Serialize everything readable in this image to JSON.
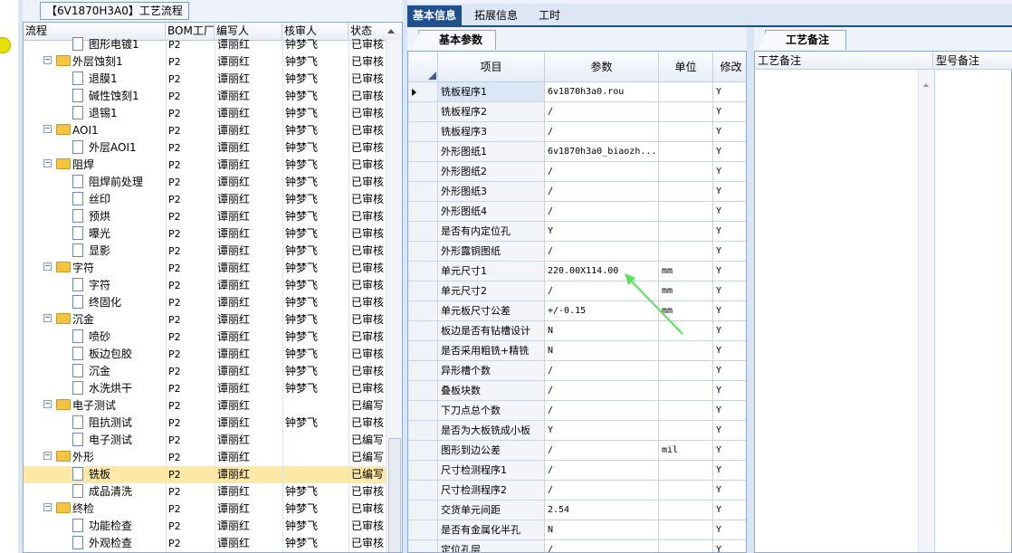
{
  "left_panel": {
    "title": "【6V1870H3A0】工艺流程",
    "columns": [
      "流程",
      "BOM工厂",
      "编写人",
      "核审人",
      "状态"
    ],
    "rows": [
      {
        "indent": 2,
        "type": "doc",
        "name": "图形电镀1",
        "bom": "P2",
        "writer": "谭丽红",
        "reviewer": "钟梦飞",
        "status": "已审核"
      },
      {
        "indent": 1,
        "type": "folder",
        "name": "外层蚀刻1",
        "bom": "P2",
        "writer": "谭丽红",
        "reviewer": "钟梦飞",
        "status": "已审核"
      },
      {
        "indent": 2,
        "type": "doc",
        "name": "退膜1",
        "bom": "P2",
        "writer": "谭丽红",
        "reviewer": "钟梦飞",
        "status": "已审核"
      },
      {
        "indent": 2,
        "type": "doc",
        "name": "碱性蚀刻1",
        "bom": "P2",
        "writer": "谭丽红",
        "reviewer": "钟梦飞",
        "status": "已审核"
      },
      {
        "indent": 2,
        "type": "doc",
        "name": "退锡1",
        "bom": "P2",
        "writer": "谭丽红",
        "reviewer": "钟梦飞",
        "status": "已审核"
      },
      {
        "indent": 1,
        "type": "folder",
        "name": "AOI1",
        "bom": "P2",
        "writer": "谭丽红",
        "reviewer": "钟梦飞",
        "status": "已审核"
      },
      {
        "indent": 2,
        "type": "doc",
        "name": "外层AOI1",
        "bom": "P2",
        "writer": "谭丽红",
        "reviewer": "钟梦飞",
        "status": "已审核"
      },
      {
        "indent": 1,
        "type": "folder",
        "name": "阻焊",
        "bom": "P2",
        "writer": "谭丽红",
        "reviewer": "钟梦飞",
        "status": "已审核"
      },
      {
        "indent": 2,
        "type": "doc",
        "name": "阻焊前处理",
        "bom": "P2",
        "writer": "谭丽红",
        "reviewer": "钟梦飞",
        "status": "已审核"
      },
      {
        "indent": 2,
        "type": "doc",
        "name": "丝印",
        "bom": "P2",
        "writer": "谭丽红",
        "reviewer": "钟梦飞",
        "status": "已审核"
      },
      {
        "indent": 2,
        "type": "doc",
        "name": "预烘",
        "bom": "P2",
        "writer": "谭丽红",
        "reviewer": "钟梦飞",
        "status": "已审核"
      },
      {
        "indent": 2,
        "type": "doc",
        "name": "曝光",
        "bom": "P2",
        "writer": "谭丽红",
        "reviewer": "钟梦飞",
        "status": "已审核"
      },
      {
        "indent": 2,
        "type": "doc",
        "name": "显影",
        "bom": "P2",
        "writer": "谭丽红",
        "reviewer": "钟梦飞",
        "status": "已审核"
      },
      {
        "indent": 1,
        "type": "folder",
        "name": "字符",
        "bom": "P2",
        "writer": "谭丽红",
        "reviewer": "钟梦飞",
        "status": "已审核"
      },
      {
        "indent": 2,
        "type": "doc",
        "name": "字符",
        "bom": "P2",
        "writer": "谭丽红",
        "reviewer": "钟梦飞",
        "status": "已审核"
      },
      {
        "indent": 2,
        "type": "doc",
        "name": "终固化",
        "bom": "P2",
        "writer": "谭丽红",
        "reviewer": "钟梦飞",
        "status": "已审核"
      },
      {
        "indent": 1,
        "type": "folder",
        "name": "沉金",
        "bom": "P2",
        "writer": "谭丽红",
        "reviewer": "钟梦飞",
        "status": "已审核"
      },
      {
        "indent": 2,
        "type": "doc",
        "name": "喷砂",
        "bom": "P2",
        "writer": "谭丽红",
        "reviewer": "钟梦飞",
        "status": "已审核"
      },
      {
        "indent": 2,
        "type": "doc",
        "name": "板边包胶",
        "bom": "P2",
        "writer": "谭丽红",
        "reviewer": "钟梦飞",
        "status": "已审核"
      },
      {
        "indent": 2,
        "type": "doc",
        "name": "沉金",
        "bom": "P2",
        "writer": "谭丽红",
        "reviewer": "钟梦飞",
        "status": "已审核"
      },
      {
        "indent": 2,
        "type": "doc",
        "name": "水洗烘干",
        "bom": "P2",
        "writer": "谭丽红",
        "reviewer": "钟梦飞",
        "status": "已审核"
      },
      {
        "indent": 1,
        "type": "folder",
        "name": "电子测试",
        "bom": "P2",
        "writer": "谭丽红",
        "reviewer": "",
        "status": "已编写"
      },
      {
        "indent": 2,
        "type": "doc",
        "name": "阻抗测试",
        "bom": "P2",
        "writer": "谭丽红",
        "reviewer": "钟梦飞",
        "status": "已审核"
      },
      {
        "indent": 2,
        "type": "doc",
        "name": "电子测试",
        "bom": "P2",
        "writer": "谭丽红",
        "reviewer": "",
        "status": "已编写"
      },
      {
        "indent": 1,
        "type": "folder",
        "name": "外形",
        "bom": "P2",
        "writer": "谭丽红",
        "reviewer": "",
        "status": "已编写"
      },
      {
        "indent": 2,
        "type": "doc",
        "name": "铣板",
        "bom": "P2",
        "writer": "谭丽红",
        "reviewer": "",
        "status": "已编写",
        "selected": true
      },
      {
        "indent": 2,
        "type": "doc",
        "name": "成品清洗",
        "bom": "P2",
        "writer": "谭丽红",
        "reviewer": "钟梦飞",
        "status": "已审核"
      },
      {
        "indent": 1,
        "type": "folder",
        "name": "终检",
        "bom": "P2",
        "writer": "谭丽红",
        "reviewer": "钟梦飞",
        "status": "已审核"
      },
      {
        "indent": 2,
        "type": "doc",
        "name": "功能检查",
        "bom": "P2",
        "writer": "谭丽红",
        "reviewer": "钟梦飞",
        "status": "已审核"
      },
      {
        "indent": 2,
        "type": "doc",
        "name": "外观检查",
        "bom": "P2",
        "writer": "谭丽红",
        "reviewer": "钟梦飞",
        "status": "已审核"
      }
    ]
  },
  "top_tabs": [
    "基本信息",
    "拓展信息",
    "工时"
  ],
  "basic_tab_label": "基本参数",
  "grid": {
    "columns": [
      "项目",
      "参数",
      "单位",
      "修改"
    ],
    "rows": [
      {
        "item": "铣板程序1",
        "param": "6v1870h3a0.rou",
        "unit": "",
        "mod": "Y"
      },
      {
        "item": "铣板程序2",
        "param": "/",
        "unit": "",
        "mod": "Y"
      },
      {
        "item": "铣板程序3",
        "param": "/",
        "unit": "",
        "mod": "Y"
      },
      {
        "item": "外形图纸1",
        "param": "6v1870h3a0_biaozh...",
        "unit": "",
        "mod": "Y"
      },
      {
        "item": "外形图纸2",
        "param": "/",
        "unit": "",
        "mod": "Y"
      },
      {
        "item": "外形图纸3",
        "param": "/",
        "unit": "",
        "mod": "Y"
      },
      {
        "item": "外形图纸4",
        "param": "/",
        "unit": "",
        "mod": "Y"
      },
      {
        "item": "是否有内定位孔",
        "param": "Y",
        "unit": "",
        "mod": "Y"
      },
      {
        "item": "外形露铜图纸",
        "param": "/",
        "unit": "",
        "mod": "Y"
      },
      {
        "item": "单元尺寸1",
        "param": "220.00X114.00",
        "unit": "mm",
        "mod": "Y"
      },
      {
        "item": "单元尺寸2",
        "param": "/",
        "unit": "mm",
        "mod": "Y"
      },
      {
        "item": "单元板尺寸公差",
        "param": "+/-0.15",
        "unit": "mm",
        "mod": "Y"
      },
      {
        "item": "板边是否有钻槽设计",
        "param": "N",
        "unit": "",
        "mod": "Y"
      },
      {
        "item": "是否采用粗铣+精铣",
        "param": "N",
        "unit": "",
        "mod": "Y"
      },
      {
        "item": "异形槽个数",
        "param": "/",
        "unit": "",
        "mod": "Y"
      },
      {
        "item": "叠板块数",
        "param": "/",
        "unit": "",
        "mod": "Y"
      },
      {
        "item": "下刀点总个数",
        "param": "/",
        "unit": "",
        "mod": "Y"
      },
      {
        "item": "是否为大板铣成小板",
        "param": "Y",
        "unit": "",
        "mod": "Y"
      },
      {
        "item": "图形到边公差",
        "param": "/",
        "unit": "mil",
        "mod": "Y"
      },
      {
        "item": "尺寸检测程序1",
        "param": "/",
        "unit": "",
        "mod": "Y"
      },
      {
        "item": "尺寸检测程序2",
        "param": "/",
        "unit": "",
        "mod": "Y"
      },
      {
        "item": "交货单元间距",
        "param": "2.54",
        "unit": "",
        "mod": "Y"
      },
      {
        "item": "是否有金属化半孔",
        "param": "N",
        "unit": "",
        "mod": "Y"
      },
      {
        "item": "定位孔层",
        "param": "/",
        "unit": "",
        "mod": "Y"
      }
    ]
  },
  "remark_panel": {
    "tab_label": "工艺备注",
    "col1": "工艺备注",
    "col2": "型号备注"
  },
  "icons": {
    "folder": "folder-icon",
    "doc": "document-icon",
    "arrow": "green-arrow-annotation"
  },
  "colors": {
    "accent": "#1f4f8e",
    "selected_row": "#fde9a6",
    "arrow": "#5be05b"
  }
}
